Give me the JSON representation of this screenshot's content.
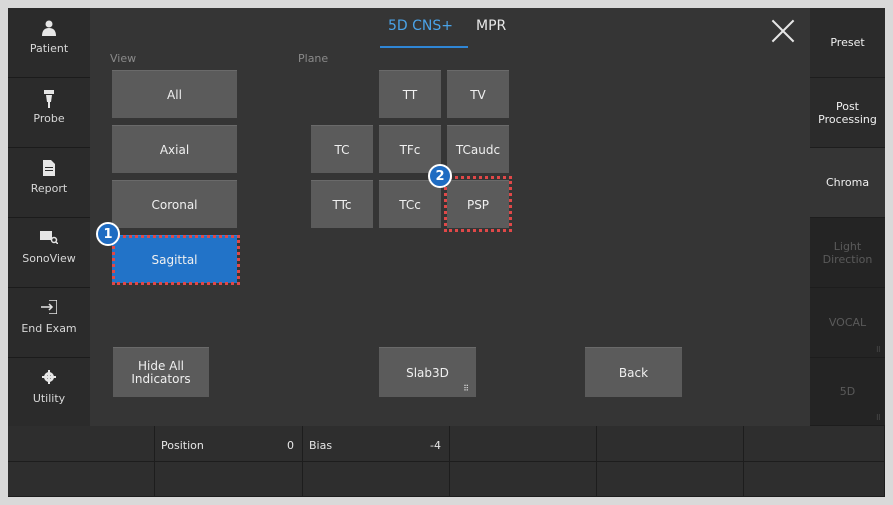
{
  "left_sidebar": {
    "items": [
      {
        "label": "Patient",
        "icon": "person-icon"
      },
      {
        "label": "Probe",
        "icon": "probe-icon"
      },
      {
        "label": "Report",
        "icon": "document-icon"
      },
      {
        "label": "SonoView",
        "icon": "sonoview-icon"
      },
      {
        "label": "End Exam",
        "icon": "exit-icon"
      },
      {
        "label": "Utility",
        "icon": "gear-icon"
      }
    ]
  },
  "tabs": {
    "active": "5D CNS+",
    "other": "MPR"
  },
  "view": {
    "label": "View",
    "buttons": [
      "All",
      "Axial",
      "Coronal",
      "Sagittal"
    ],
    "selected": "Sagittal"
  },
  "plane": {
    "label": "Plane",
    "row1": [
      "TT",
      "TV"
    ],
    "row2": [
      "TC",
      "TFc",
      "TCaudc"
    ],
    "row3": [
      "TTc",
      "TCc",
      "PSP"
    ]
  },
  "actions": {
    "hide_all": "Hide All\nIndicators",
    "slab": "Slab3D",
    "back": "Back"
  },
  "annotations": {
    "marker1": "1",
    "marker2": "2"
  },
  "right_sidebar": {
    "items": [
      "Preset",
      "Post Processing",
      "Chroma",
      "Light Direction",
      "VOCAL",
      "5D"
    ]
  },
  "bottom": {
    "position_label": "Position",
    "position_value": "0",
    "bias_label": "Bias",
    "bias_value": "-4"
  },
  "colors": {
    "accent": "#2273c8",
    "highlight_border": "#e04848"
  }
}
